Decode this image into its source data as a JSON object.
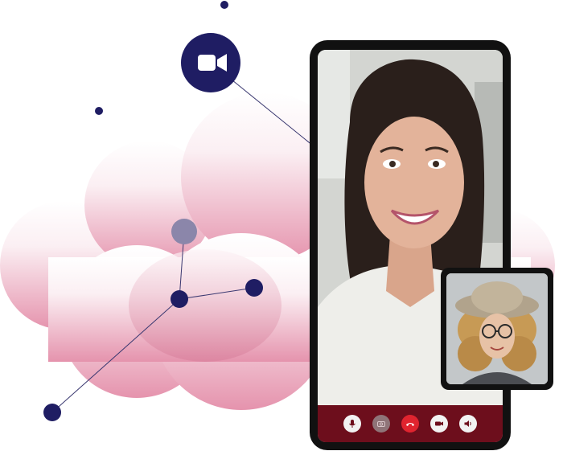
{
  "colors": {
    "navy": "#1f1d63",
    "node_light": "#8b86aa",
    "cloud_pink": "#e8a6bb",
    "call_bar": "#6d0e1c",
    "end_call": "#e0242f"
  },
  "icons": {
    "badge": "video-camera-icon",
    "controls": [
      "microphone-icon",
      "camera-icon",
      "end-call-icon",
      "video-icon",
      "speaker-icon"
    ]
  }
}
